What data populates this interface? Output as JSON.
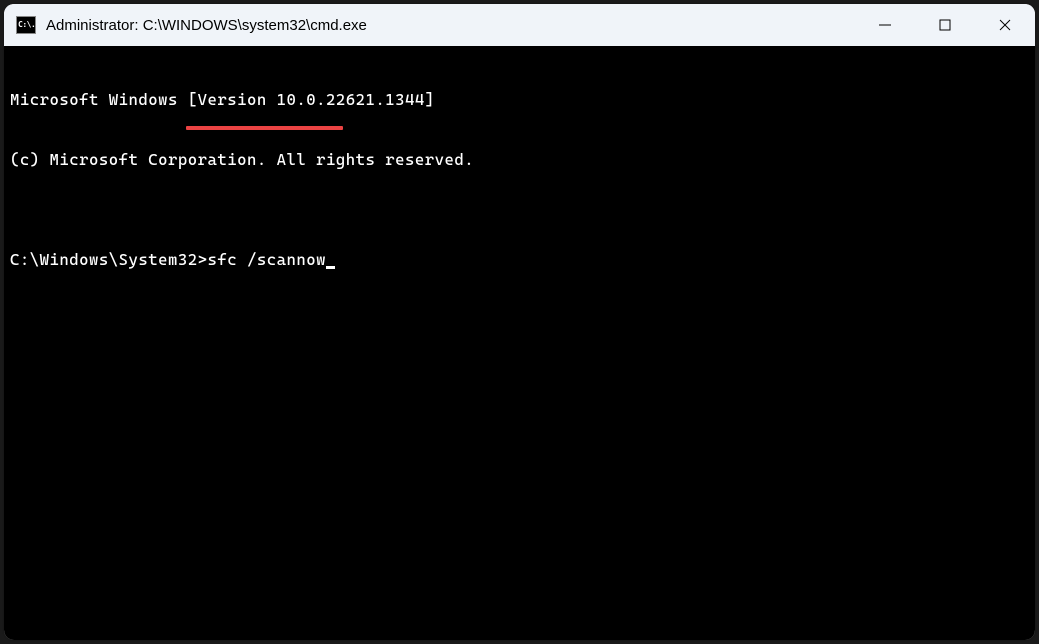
{
  "window": {
    "title": "Administrator: C:\\WINDOWS\\system32\\cmd.exe",
    "app_icon_text": "C:\\."
  },
  "terminal": {
    "line1": "Microsoft Windows [Version 10.0.22621.1344]",
    "line2": "(c) Microsoft Corporation. All rights reserved.",
    "blank": "",
    "prompt_path": "C:\\Windows\\System32>",
    "command": "sfc /scannow"
  },
  "annotation": {
    "underline_color": "#eb4343"
  }
}
